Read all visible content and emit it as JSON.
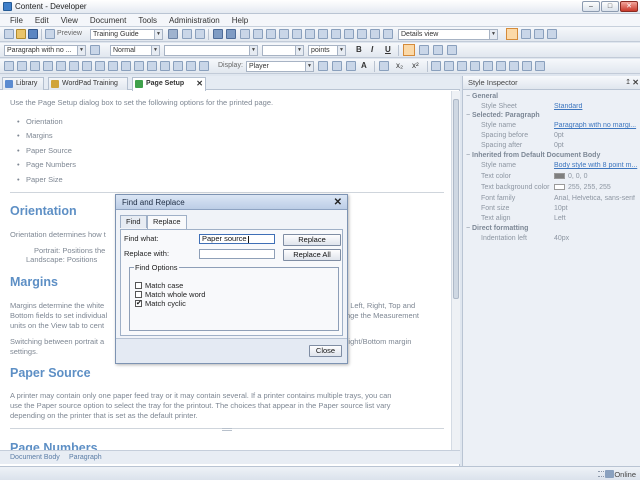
{
  "window": {
    "title": "Content - Developer",
    "minimize": "–",
    "maximize": "□",
    "close": "✕"
  },
  "menu": [
    "File",
    "Edit",
    "View",
    "Document",
    "Tools",
    "Administration",
    "Help"
  ],
  "toolbar": {
    "preview_label": "Preview",
    "template_value": "Training Guide",
    "view_value": "Details view",
    "paragraph_style_value": "Paragraph with no ...",
    "character_style_value": "Normal",
    "font_value": "",
    "size_value": "",
    "unit_value": "points",
    "display_label": "Display:",
    "display_value": "Player",
    "bold": "B",
    "italic": "I",
    "underline": "U",
    "font_label": "A",
    "subscript": "x₂",
    "superscript": "x²"
  },
  "doc_tabs": [
    {
      "label": "Library",
      "icon_color": "#5b8bd0"
    },
    {
      "label": "WordPad Training",
      "icon_color": "#d0a43a"
    },
    {
      "label": "Page Setup",
      "icon_color": "#3fa14b",
      "close": "✕"
    }
  ],
  "document": {
    "intro": "Use the Page Setup dialog box to set the following options for the printed page.",
    "bullets": [
      "Orientation",
      "Margins",
      "Paper Source",
      "Page Numbers",
      "Paper Size"
    ],
    "orientation_heading": "Orientation",
    "orientation_text": "Orientation determines how t",
    "portrait_text": "Portrait: Positions the",
    "landscape_text": "Landscape: Positions",
    "margins_heading": "Margins",
    "margins_text_1": "Margins determine the white",
    "margins_text_1b": "e Left, Right, Top and",
    "margins_text_2": "Bottom fields to set individual",
    "margins_text_2b": "nge the Measurement",
    "margins_text_3": "units on the View tab to cent",
    "switching_text_1": "Switching between portrait a",
    "switching_text_1b": "Right/Bottom margin",
    "switching_text_2": "settings.",
    "paper_heading": "Paper Source",
    "paper_text_1": "A printer may contain only one paper feed tray or it may contain several. If a printer contains multiple trays, you can",
    "paper_text_2": "use the Paper source option to select the tray for the printout. The choices that appear in the Paper source list vary",
    "paper_text_3": "depending on the printer that is set as the default printer.",
    "next_heading": "Page Numbers"
  },
  "doc_status": {
    "crumb_1": "Document Body",
    "crumb_2": "Paragraph"
  },
  "inspector": {
    "title": "Style Inspector",
    "pin": "↥",
    "close": "✕",
    "sections": {
      "general": "General",
      "selected": "Selected: Paragraph",
      "inherited": "Inherited from Default Document Body",
      "direct": "Direct formatting"
    },
    "general": {
      "style_sheet_key": "Style Sheet",
      "style_sheet_val": "Standard"
    },
    "selected": {
      "style_name_key": "Style name",
      "style_name_val": "Paragraph with no margi...",
      "spacing_before_key": "Spacing before",
      "spacing_before_val": "0pt",
      "spacing_after_key": "Spacing after",
      "spacing_after_val": "0pt"
    },
    "inherited": {
      "style_name_key": "Style name",
      "style_name_val": "Body style with 8 point m...",
      "text_color_key": "Text color",
      "text_color_val": "0, 0, 0",
      "text_color_hex": "#7f7f7f",
      "text_bg_key": "Text background color",
      "text_bg_val": "255, 255, 255",
      "text_bg_hex": "#ffffff",
      "font_family_key": "Font family",
      "font_family_val": "Arial, Helvetica, sans-serif",
      "font_size_key": "Font size",
      "font_size_val": "10pt",
      "text_align_key": "Text align",
      "text_align_val": "Left"
    },
    "direct": {
      "indent_key": "Indentation left",
      "indent_val": "40px"
    }
  },
  "status": {
    "online": "Online"
  },
  "dialog": {
    "title": "Find and Replace",
    "close": "✕",
    "tabs": [
      "Find",
      "Replace"
    ],
    "find_label": "Find what:",
    "find_value": "Paper source",
    "replace_label": "Replace with:",
    "replace_value": "",
    "replace_button": "Replace",
    "replace_all_button": "Replace All",
    "options_legend": "Find Options",
    "options": [
      {
        "label": "Match case",
        "checked": false
      },
      {
        "label": "Match whole word",
        "checked": false
      },
      {
        "label": "Match cyclic",
        "checked": true
      }
    ],
    "close_button": "Close",
    "check_mark": "✔"
  }
}
